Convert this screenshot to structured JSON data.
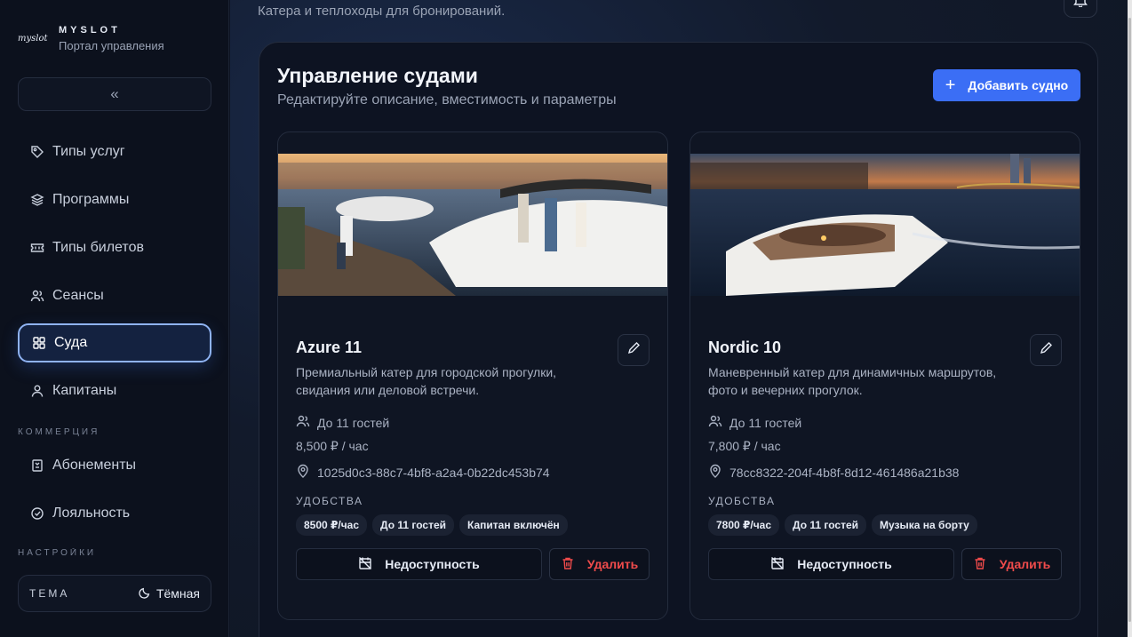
{
  "brand": {
    "logo": "myslot",
    "title": "MYSLOT",
    "subtitle": "Портал управления"
  },
  "sidebar": {
    "collapse_label": "«",
    "items": [
      {
        "label": "Типы услуг",
        "icon": "tag-icon"
      },
      {
        "label": "Программы",
        "icon": "layers-icon"
      },
      {
        "label": "Типы билетов",
        "icon": "ticket-icon"
      },
      {
        "label": "Сеансы",
        "icon": "users-icon"
      },
      {
        "label": "Суда",
        "icon": "grid-icon",
        "active": true
      },
      {
        "label": "Капитаны",
        "icon": "user-icon"
      },
      {
        "label": "Абонементы",
        "icon": "bookmark-icon"
      },
      {
        "label": "Лояльность",
        "icon": "loyalty-icon"
      }
    ],
    "sections": {
      "commerce": "КОММЕРЦИЯ",
      "settings": "НАСТРОЙКИ"
    },
    "theme": {
      "label": "ТЕМА",
      "value": "Тёмная"
    }
  },
  "header": {
    "subtitle": "Катера и теплоходы для бронирований."
  },
  "panel": {
    "title": "Управление судами",
    "subtitle": "Редактируйте описание, вместимость и параметры",
    "add_label": "Добавить судно"
  },
  "boats": [
    {
      "name": "Azure 11",
      "description": "Премиальный катер для городской прогулки, свидания или деловой встречи.",
      "capacity": "До 11 гостей",
      "price": "8,500 ₽ / час",
      "location_id": "1025d0c3-88c7-4bf8-a2a4-0b22dc453b74",
      "amenities_label": "УДОБСТВА",
      "tags": [
        "8500 ₽/час",
        "До 11 гостей",
        "Капитан включён"
      ],
      "unavailable_label": "Недоступность",
      "delete_label": "Удалить"
    },
    {
      "name": "Nordic 10",
      "description": "Маневренный катер для динамичных маршрутов, фото и вечерних прогулок.",
      "capacity": "До 11 гостей",
      "price": "7,800 ₽ / час",
      "location_id": "78cc8322-204f-4b8f-8d12-461486a21b38",
      "amenities_label": "УДОБСТВА",
      "tags": [
        "7800 ₽/час",
        "До 11 гостей",
        "Музыка на борту"
      ],
      "unavailable_label": "Недоступность",
      "delete_label": "Удалить"
    }
  ],
  "colors": {
    "accent": "#3b6ef5",
    "danger": "#f04b4b",
    "active_border": "#8fb3f2"
  }
}
